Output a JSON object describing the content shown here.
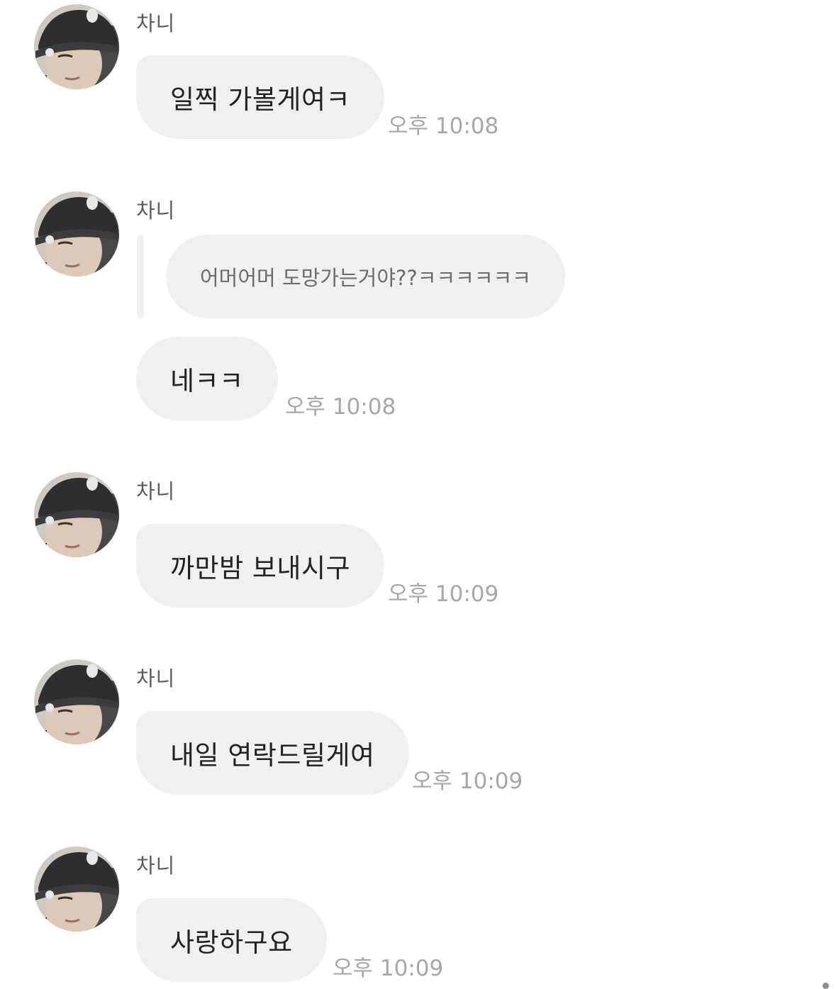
{
  "chat": {
    "avatar_icon": "profile-photo-icon",
    "messages": [
      {
        "sender": "차니",
        "text": "일찍 가볼게여ㅋ",
        "time": "오후 10:08"
      },
      {
        "sender": "차니",
        "quoted_text": "어머어머 도망가는거야??ㅋㅋㅋㅋㅋㅋ",
        "text": "네ㅋㅋ",
        "time": "오후 10:08"
      },
      {
        "sender": "차니",
        "text": "까만밤 보내시구",
        "time": "오후 10:09"
      },
      {
        "sender": "차니",
        "text": "내일 연락드릴게여",
        "time": "오후 10:09"
      },
      {
        "sender": "차니",
        "text": "사랑하구요",
        "time": "오후 10:09"
      }
    ]
  },
  "colors": {
    "bubble": "#f0f0f2",
    "text": "#222226",
    "sender": "#5b5b5f",
    "time": "#a6a6ab"
  }
}
